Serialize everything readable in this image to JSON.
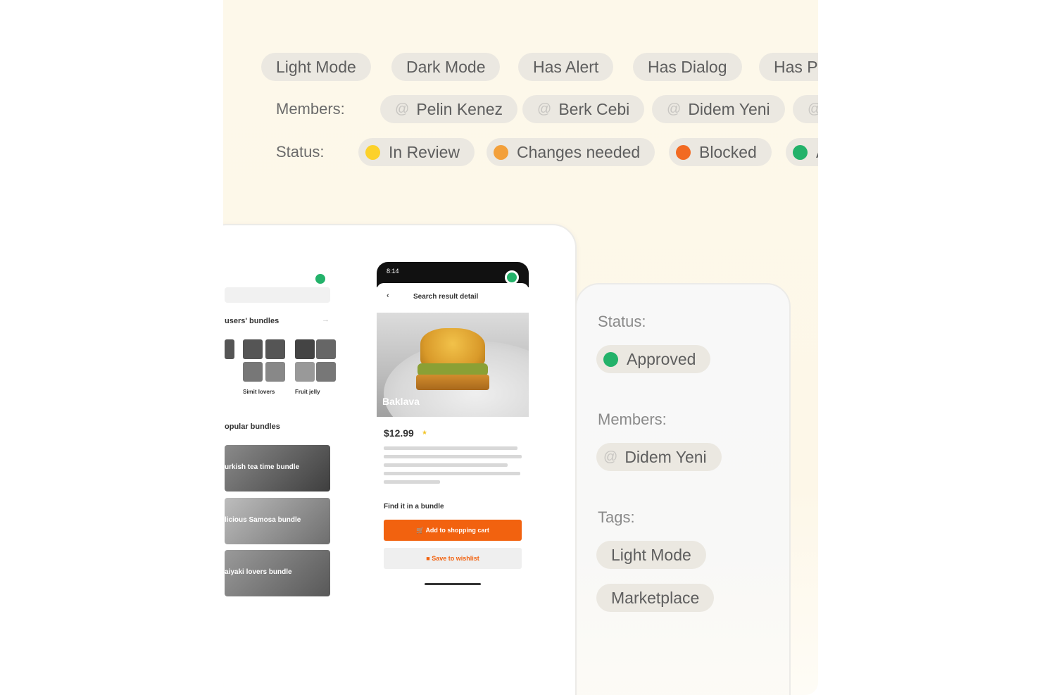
{
  "tags_row": [
    "Light Mode",
    "Dark Mode",
    "Has Alert",
    "Has Dialog",
    "Has P"
  ],
  "members_row": {
    "label": "Members:",
    "items": [
      "Pelin Kenez",
      "Berk Cebi",
      "Didem Yeni",
      ""
    ]
  },
  "status_row": {
    "label": "Status:",
    "items": [
      {
        "label": "In Review",
        "color": "#fcd12a"
      },
      {
        "label": "Changes needed",
        "color": "#f3a03a"
      },
      {
        "label": "Blocked",
        "color": "#f26a22"
      },
      {
        "label": "A",
        "color": "#23b26a"
      }
    ]
  },
  "phone_left": {
    "section1": "users' bundles",
    "bundle1": "Simit lovers",
    "bundle2": "Fruit jelly",
    "section2": "opular bundles",
    "cards": [
      "urkish tea time bundle",
      "licious Samosa bundle",
      "aiyaki lovers bundle"
    ]
  },
  "phone_right": {
    "time": "8:14",
    "header": "Search result detail",
    "dish": "Baklava",
    "price": "$12.99",
    "find_label": "Find it in a bundle",
    "primary_button": "Add to shopping cart",
    "secondary_button": "Save to wishlist"
  },
  "side_panel": {
    "status_label": "Status:",
    "status_value": "Approved",
    "status_color": "#23b26a",
    "members_label": "Members:",
    "member": "Didem Yeni",
    "tags_label": "Tags:",
    "tags": [
      "Light Mode",
      "Marketplace"
    ]
  },
  "colors": {
    "background": "#fdf8ea",
    "pill": "#ebe8e1",
    "accent": "#f2620f",
    "approved": "#23b26a"
  }
}
